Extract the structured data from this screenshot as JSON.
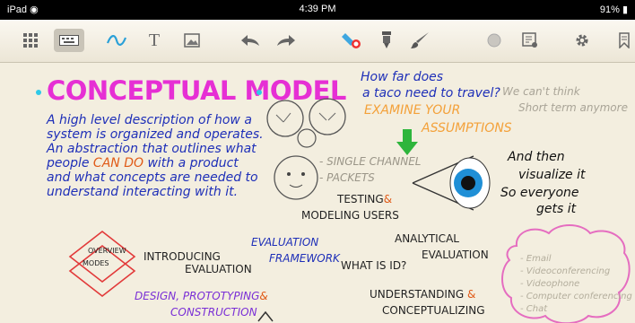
{
  "status": {
    "device": "iPad",
    "time": "4:39 PM",
    "battery": "91%"
  },
  "toolbar": {
    "icons": [
      "grid-icon",
      "keyboard-icon",
      "pen-icon",
      "text-icon",
      "image-icon",
      "undo-icon",
      "redo-icon",
      "highlighter-icon",
      "marker-icon",
      "brush-icon",
      "color-dot-icon",
      "page-icon",
      "settings-icon",
      "bookmark-icon"
    ]
  },
  "note": {
    "title": "CONCEPTUAL MODEL",
    "desc": [
      "A high level description of how a",
      "system is organized and operates.",
      "An abstraction that outlines what",
      "people",
      "CAN DO",
      "with a product",
      "and what concepts are needed to",
      "understand interacting with it."
    ],
    "q1": "How far does",
    "q2": "a taco need to travel?",
    "aside1": "We can't think",
    "aside2": "Short term anymore",
    "examine1": "EXAMINE YOUR",
    "examine2": "ASSUMPTIONS",
    "channel1": "- SINGLE CHANNEL",
    "channel2": "- PACKETS",
    "testing": "TESTING",
    "amp1": "&",
    "modeling": "MODELING USERS",
    "then1": "And then",
    "then2": "visualize it",
    "then3": "So everyone",
    "then4": "gets it",
    "overview1": "OVERVIEW",
    "overview2": "MODES",
    "introducing1": "INTRODUCING",
    "introducing2": "EVALUATION",
    "evalframework1": "EVALUATION",
    "evalframework2": "FRAMEWORK",
    "analytical1": "ANALYTICAL",
    "analytical2": "EVALUATION",
    "whatisid": "WHAT IS ID?",
    "design1": "DESIGN, PROTOTYPING",
    "amp2": "&",
    "design2": "CONSTRUCTION",
    "understanding1": "UNDERSTANDING",
    "amp3": "&",
    "understanding2": "CONCEPTUALIZING",
    "cloud": [
      "- Email",
      "- Videoconferencing",
      "- Videophone",
      "- Computer conferencing",
      "- Chat"
    ]
  }
}
